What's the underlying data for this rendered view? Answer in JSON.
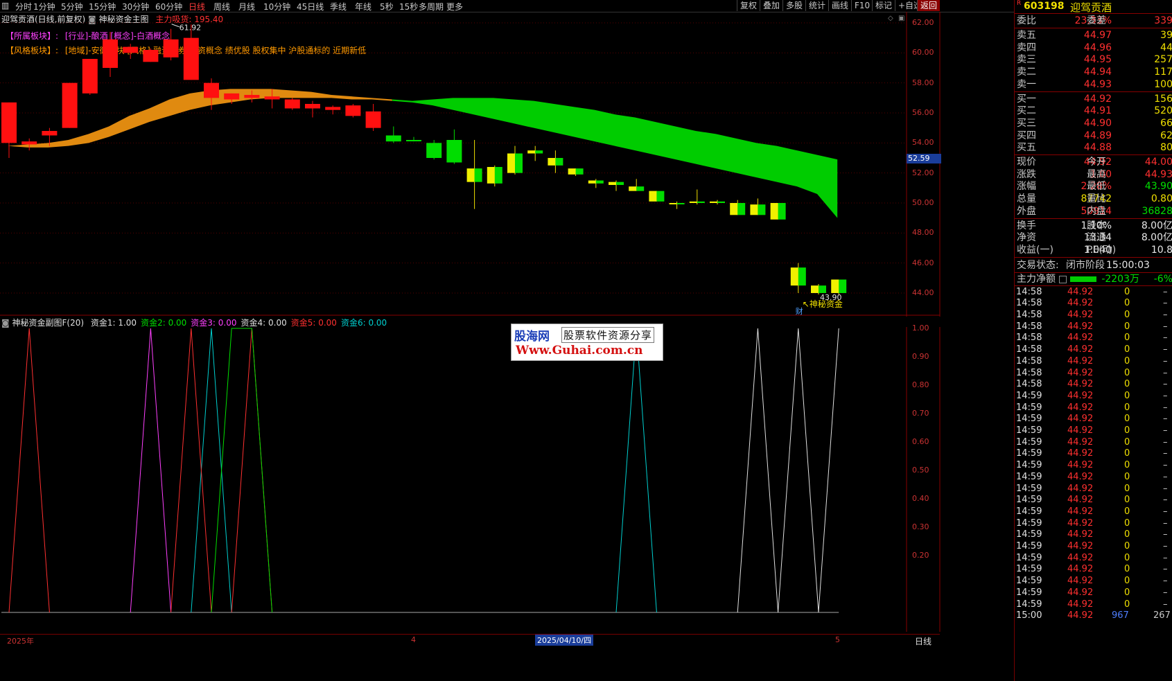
{
  "toolbar": {
    "periods": [
      "分时",
      "1分钟",
      "5分钟",
      "15分钟",
      "30分钟",
      "60分钟",
      "日线",
      "周线",
      "月线",
      "10分钟",
      "45日线",
      "季线",
      "年线",
      "5秒",
      "15秒",
      "多周期",
      "更多"
    ],
    "active_period": "日线",
    "right_tools": [
      "复权",
      "叠加",
      "多股",
      "统计",
      "画线",
      "F10",
      "标记",
      "+自选",
      "返回"
    ],
    "active_tool": "返回"
  },
  "main_chart": {
    "title": "迎驾贡酒(日线,前复权)",
    "indicator": "神秘资金主图",
    "indicator_value_label": "主力吸货: 195.40",
    "industry_label": "【所属板块】:",
    "industry_text": "[行业]-酿酒 [概念]-白酒概念",
    "style_label": "【风格板块】:",
    "style_text": "[地域]-安徽板块 [风格]-融资融券 融资概念 绩优股 股权集中 沪股通标的 近期新低",
    "high_label": "61.92",
    "low_label": "43.90",
    "signal_label": "神秘资金",
    "finance_badge": "财",
    "current_price_tag": "52.59",
    "y_axis": [
      "62.00",
      "60.00",
      "58.00",
      "56.00",
      "54.00",
      "52.00",
      "50.00",
      "48.00",
      "46.00",
      "44.00"
    ]
  },
  "sub_chart": {
    "title": "神秘资金副图F(20)",
    "labels": [
      {
        "text": "资金1: 1.00",
        "color": "#e0e0e0"
      },
      {
        "text": "资金2: 0.00",
        "color": "#00e000"
      },
      {
        "text": "资金3: 0.00",
        "color": "#ff40ff"
      },
      {
        "text": "资金4: 0.00",
        "color": "#e0e0e0"
      },
      {
        "text": "资金5: 0.00",
        "color": "#ff3030"
      },
      {
        "text": "资金6: 0.00",
        "color": "#00d0d0"
      }
    ],
    "y_axis": [
      "1.00",
      "0.90",
      "0.80",
      "0.70",
      "0.60",
      "0.50",
      "0.40",
      "0.30",
      "0.20"
    ]
  },
  "date_axis": {
    "start": "2025年",
    "mid": "4",
    "highlight": "2025/04/10/四",
    "end": "5",
    "period_button": "日线"
  },
  "watermark": {
    "brand": "股海网",
    "slogan": "股票软件资源分享",
    "url": "Www.Guhai.com.cn"
  },
  "quote_panel": {
    "code": "603198",
    "name": "迎驾贡酒",
    "r_marker": "R",
    "weibi_label": "委比",
    "weibi": "23.33%",
    "weicha_label": "委差",
    "weicha": "339",
    "asks": [
      {
        "label": "卖五",
        "price": "44.97",
        "vol": "39"
      },
      {
        "label": "卖四",
        "price": "44.96",
        "vol": "44"
      },
      {
        "label": "卖三",
        "price": "44.95",
        "vol": "257"
      },
      {
        "label": "卖二",
        "price": "44.94",
        "vol": "117"
      },
      {
        "label": "卖一",
        "price": "44.93",
        "vol": "100"
      }
    ],
    "bids": [
      {
        "label": "买一",
        "price": "44.92",
        "vol": "156"
      },
      {
        "label": "买二",
        "price": "44.91",
        "vol": "520"
      },
      {
        "label": "买三",
        "price": "44.90",
        "vol": "66"
      },
      {
        "label": "买四",
        "price": "44.89",
        "vol": "62"
      },
      {
        "label": "买五",
        "price": "44.88",
        "vol": "80"
      }
    ],
    "stats": [
      {
        "l1": "现价",
        "v1": "44.92",
        "c1": "red",
        "l2": "今开",
        "v2": "44.00",
        "c2": "red"
      },
      {
        "l1": "涨跌",
        "v1": "1.00",
        "c1": "red",
        "l2": "最高",
        "v2": "44.93",
        "c2": "red"
      },
      {
        "l1": "涨幅",
        "v1": "2.28%",
        "c1": "red",
        "l2": "最低",
        "v2": "43.90",
        "c2": "green"
      },
      {
        "l1": "总量",
        "v1": "87742",
        "c1": "yellow",
        "l2": "量比",
        "v2": "0.80",
        "c2": "yellow"
      },
      {
        "l1": "外盘",
        "v1": "50914",
        "c1": "red",
        "l2": "内盘",
        "v2": "36828",
        "c2": "green"
      }
    ],
    "stats2": [
      {
        "l1": "换手",
        "v1": "1.10%",
        "l2": "股本",
        "v2": "8.00亿"
      },
      {
        "l1": "净资",
        "v1": "13.34",
        "l2": "流通",
        "v2": "8.00亿"
      },
      {
        "l1": "收益(一)",
        "v1": "1.040",
        "l2": "PE(动)",
        "v2": "10.8"
      }
    ],
    "trade_status_label": "交易状态:",
    "trade_status": "闭市阶段",
    "trade_time": "15:00:03",
    "main_net_label": "主力净额",
    "main_net_value": "-2203万",
    "main_net_pct": "-6%",
    "ticks": [
      {
        "t": "14:58",
        "p": "44.92",
        "v": "0"
      },
      {
        "t": "14:58",
        "p": "44.92",
        "v": "0"
      },
      {
        "t": "14:58",
        "p": "44.92",
        "v": "0"
      },
      {
        "t": "14:58",
        "p": "44.92",
        "v": "0"
      },
      {
        "t": "14:58",
        "p": "44.92",
        "v": "0"
      },
      {
        "t": "14:58",
        "p": "44.92",
        "v": "0"
      },
      {
        "t": "14:58",
        "p": "44.92",
        "v": "0"
      },
      {
        "t": "14:58",
        "p": "44.92",
        "v": "0"
      },
      {
        "t": "14:58",
        "p": "44.92",
        "v": "0"
      },
      {
        "t": "14:59",
        "p": "44.92",
        "v": "0"
      },
      {
        "t": "14:59",
        "p": "44.92",
        "v": "0"
      },
      {
        "t": "14:59",
        "p": "44.92",
        "v": "0"
      },
      {
        "t": "14:59",
        "p": "44.92",
        "v": "0"
      },
      {
        "t": "14:59",
        "p": "44.92",
        "v": "0"
      },
      {
        "t": "14:59",
        "p": "44.92",
        "v": "0"
      },
      {
        "t": "14:59",
        "p": "44.92",
        "v": "0"
      },
      {
        "t": "14:59",
        "p": "44.92",
        "v": "0"
      },
      {
        "t": "14:59",
        "p": "44.92",
        "v": "0"
      },
      {
        "t": "14:59",
        "p": "44.92",
        "v": "0"
      },
      {
        "t": "14:59",
        "p": "44.92",
        "v": "0"
      },
      {
        "t": "14:59",
        "p": "44.92",
        "v": "0"
      },
      {
        "t": "14:59",
        "p": "44.92",
        "v": "0"
      },
      {
        "t": "14:59",
        "p": "44.92",
        "v": "0"
      },
      {
        "t": "14:59",
        "p": "44.92",
        "v": "0"
      },
      {
        "t": "14:59",
        "p": "44.92",
        "v": "0"
      },
      {
        "t": "14:59",
        "p": "44.92",
        "v": "0"
      },
      {
        "t": "14:59",
        "p": "44.92",
        "v": "0"
      },
      {
        "t": "14:59",
        "p": "44.92",
        "v": "0"
      },
      {
        "t": "15:00",
        "p": "44.92",
        "v": "967"
      }
    ],
    "last_tick_extra": "267"
  },
  "chart_data": {
    "type": "candlestick",
    "ylim": [
      43.5,
      62.5
    ],
    "candles": [
      {
        "o": 54.0,
        "h": 56.7,
        "l": 53.0,
        "c": 56.7
      },
      {
        "o": 53.9,
        "h": 54.3,
        "l": 53.5,
        "c": 54.1
      },
      {
        "o": 54.5,
        "h": 55.0,
        "l": 53.8,
        "c": 54.8
      },
      {
        "o": 55.0,
        "h": 58.0,
        "l": 55.0,
        "c": 58.0
      },
      {
        "o": 57.3,
        "h": 59.6,
        "l": 57.2,
        "c": 59.6
      },
      {
        "o": 59.0,
        "h": 61.4,
        "l": 58.4,
        "c": 60.9
      },
      {
        "o": 60.0,
        "h": 60.6,
        "l": 59.6,
        "c": 60.4
      },
      {
        "o": 59.4,
        "h": 60.3,
        "l": 59.4,
        "c": 60.2
      },
      {
        "o": 59.7,
        "h": 61.6,
        "l": 59.5,
        "c": 60.9
      },
      {
        "o": 58.2,
        "h": 61.9,
        "l": 58.2,
        "c": 61.0
      },
      {
        "o": 57.0,
        "h": 58.3,
        "l": 56.2,
        "c": 58.0
      },
      {
        "o": 56.9,
        "h": 57.3,
        "l": 56.6,
        "c": 57.3
      },
      {
        "o": 57.0,
        "h": 57.5,
        "l": 56.7,
        "c": 57.2
      },
      {
        "o": 56.9,
        "h": 57.6,
        "l": 56.3,
        "c": 57.1
      },
      {
        "o": 56.3,
        "h": 57.0,
        "l": 56.2,
        "c": 56.9
      },
      {
        "o": 56.3,
        "h": 56.8,
        "l": 55.7,
        "c": 56.6
      },
      {
        "o": 56.2,
        "h": 56.5,
        "l": 55.9,
        "c": 56.4
      },
      {
        "o": 55.8,
        "h": 56.6,
        "l": 55.7,
        "c": 56.5
      },
      {
        "o": 55.0,
        "h": 56.6,
        "l": 54.8,
        "c": 56.1
      },
      {
        "o": 54.5,
        "h": 55.1,
        "l": 54.0,
        "c": 54.1
      },
      {
        "o": 54.2,
        "h": 54.4,
        "l": 54.1,
        "c": 54.2
      },
      {
        "o": 54.0,
        "h": 54.2,
        "l": 52.9,
        "c": 53.0
      },
      {
        "o": 54.2,
        "h": 54.9,
        "l": 52.6,
        "c": 52.7
      },
      {
        "o": 52.3,
        "h": 54.2,
        "l": 49.6,
        "c": 51.4
      },
      {
        "o": 51.3,
        "h": 52.5,
        "l": 51.1,
        "c": 52.4
      },
      {
        "o": 52.0,
        "h": 53.8,
        "l": 51.9,
        "c": 53.3
      },
      {
        "o": 53.5,
        "h": 53.8,
        "l": 52.8,
        "c": 53.3
      },
      {
        "o": 52.5,
        "h": 53.5,
        "l": 52.0,
        "c": 53.0
      },
      {
        "o": 51.9,
        "h": 52.3,
        "l": 51.8,
        "c": 52.3
      },
      {
        "o": 51.3,
        "h": 51.6,
        "l": 51.0,
        "c": 51.5
      },
      {
        "o": 51.2,
        "h": 51.5,
        "l": 50.8,
        "c": 51.4
      },
      {
        "o": 50.8,
        "h": 51.6,
        "l": 50.8,
        "c": 51.1
      },
      {
        "o": 50.1,
        "h": 50.8,
        "l": 50.1,
        "c": 50.8
      },
      {
        "o": 50.0,
        "h": 50.1,
        "l": 49.6,
        "c": 50.0
      },
      {
        "o": 50.0,
        "h": 50.9,
        "l": 49.9,
        "c": 50.1
      },
      {
        "o": 50.0,
        "h": 50.2,
        "l": 49.9,
        "c": 50.1
      },
      {
        "o": 49.2,
        "h": 50.2,
        "l": 49.2,
        "c": 50.0
      },
      {
        "o": 49.2,
        "h": 50.3,
        "l": 49.2,
        "c": 49.9
      },
      {
        "o": 48.9,
        "h": 50.0,
        "l": 48.9,
        "c": 50.0
      },
      {
        "o": 44.5,
        "h": 46.0,
        "l": 44.0,
        "c": 45.7
      },
      {
        "o": 44.0,
        "h": 44.6,
        "l": 43.9,
        "c": 44.5
      },
      {
        "o": 44.0,
        "h": 44.9,
        "l": 43.9,
        "c": 44.9
      }
    ],
    "band_upper": [
      53.8,
      53.9,
      54.0,
      54.2,
      54.6,
      55.1,
      55.8,
      56.3,
      56.9,
      57.3,
      57.5,
      57.6,
      57.6,
      57.6,
      57.5,
      57.4,
      57.2,
      57.1,
      57.0,
      56.9,
      56.8,
      56.9,
      57.0,
      57.0,
      57.0,
      56.9,
      56.8,
      56.6,
      56.4,
      56.2,
      55.9,
      55.7,
      55.4,
      55.1,
      54.8,
      54.6,
      54.3,
      54.0,
      53.8,
      53.5,
      53.2,
      52.9
    ],
    "band_lower": [
      53.8,
      53.7,
      53.7,
      53.8,
      54.0,
      54.4,
      54.9,
      55.4,
      55.8,
      56.2,
      56.5,
      56.7,
      56.9,
      57.0,
      57.0,
      57.0,
      57.0,
      56.9,
      56.9,
      56.8,
      56.7,
      56.5,
      56.2,
      55.9,
      55.6,
      55.3,
      55.0,
      54.7,
      54.4,
      54.1,
      53.8,
      53.5,
      53.2,
      52.9,
      52.6,
      52.3,
      52.0,
      51.7,
      51.4,
      51.1,
      50.6,
      49.0
    ],
    "sub_series": [
      {
        "name": "资金1",
        "color": "#e0e0e0",
        "peaks": [
          37,
          39,
          41
        ]
      },
      {
        "name": "资金6",
        "color": "#00d0d0",
        "peaks": [
          10,
          31
        ]
      },
      {
        "name": "资金3",
        "color": "#ff40ff",
        "peaks": [
          7
        ]
      },
      {
        "name": "资金5",
        "color": "#ff3030",
        "peaks": [
          1,
          9,
          12
        ]
      },
      {
        "name": "资金4",
        "color": "#e0e0e0",
        "peaks": []
      },
      {
        "name": "资金2",
        "color": "#00e000",
        "peaks": [
          11
        ]
      }
    ]
  }
}
